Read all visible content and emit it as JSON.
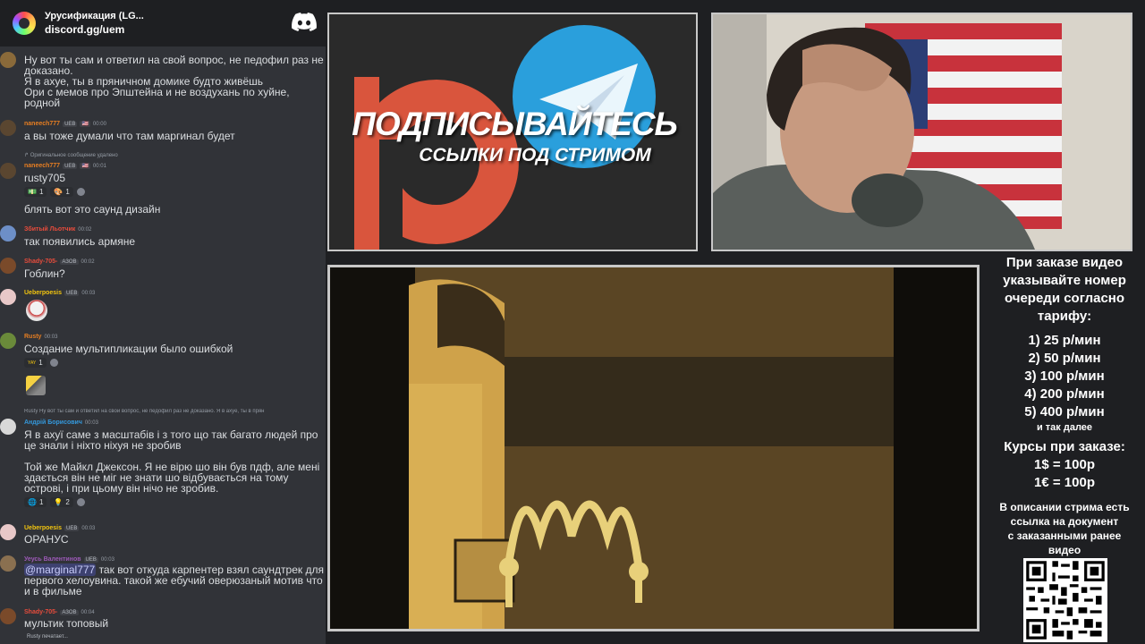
{
  "server": {
    "name": "Урусификация (LG...",
    "invite": "discord.gg/uem",
    "logo_icon": "discord-logo-icon"
  },
  "messages": [
    {
      "id": "m0",
      "body": "Ну вот ты сам и ответил на свой вопрос, не педофил раз не доказано.\nЯ в ахуе, ты в пряничном домике будто живёшь\nОри с мемов про Эпштейна и не воздухань по хуйне, родной"
    },
    {
      "id": "m1",
      "author": "naneech777",
      "badge1": "UEB",
      "badge2": "🇺🇸",
      "time": "00:00",
      "author_color": "#e67e22",
      "body": "а вы тоже думали что там маргинал будет"
    },
    {
      "id": "m2",
      "reply": "↱ Оригинальное сообщение удалено",
      "author": "naneech777",
      "badge1": "UEB",
      "badge2": "🇺🇸",
      "time": "00:01",
      "author_color": "#e67e22",
      "body": "rusty705",
      "reacts": [
        {
          "emoji": "💵",
          "count": "1"
        },
        {
          "emoji": "🎨",
          "count": "1"
        }
      ]
    },
    {
      "id": "m3",
      "body": "блять вот это саунд дизайн"
    },
    {
      "id": "m4",
      "author": "Збитый Льотчик",
      "time": "00:02",
      "author_color": "#e74c3c",
      "body": "так появились армяне"
    },
    {
      "id": "m5",
      "author": "Shady-705-",
      "badge1": "АЗОВ",
      "time": "00:02",
      "author_color": "#e74c3c",
      "body": "Гоблин?"
    },
    {
      "id": "m6",
      "author": "Ueberpoesis",
      "badge1": "UEB",
      "time": "00:03",
      "author_color": "#f1c40f"
    },
    {
      "id": "m7",
      "author": "Rusty",
      "time": "00:03",
      "author_color": "#e67e22",
      "body": "Создание мультипликации было ошибкой",
      "reacts": [
        {
          "emoji": "YAY",
          "count": "1"
        }
      ]
    },
    {
      "id": "m8",
      "reply": "Rusty Ну вот ты сам и ответил на свой вопрос, не педофил раз не доказано. Я в ахуе, ты в прян",
      "author": "Андрій Борисович",
      "time": "00:03",
      "author_color": "#3498db",
      "body": "Я в ахуї саме з масштабів і з того що так багато людей про це знали і ніхто ніхуя не зробив",
      "body2": "Той же Майкл Джексон. Я не вірю шо він був пдф, але мені здається він не міг не знати шо відбувається на тому острові, і при цьому він нічо не зробив.",
      "reacts": [
        {
          "emoji": "🌐",
          "count": "1"
        },
        {
          "emoji": "💡",
          "count": "2"
        }
      ]
    },
    {
      "id": "m9",
      "author": "Ueberpoesis",
      "badge1": "UEB",
      "time": "00:03",
      "author_color": "#f1c40f",
      "body": "ОРАНУС"
    },
    {
      "id": "m10",
      "author": "Уеусь Валентинов",
      "badge1": "UEB",
      "time": "00:03",
      "author_color": "#9b59b6",
      "mention": "@marginal777",
      "body": " так вот откуда карпентер взял саундтрек для первого хелоувина. такой же ебучий оверюзаный мотив что и в фильме"
    },
    {
      "id": "m11",
      "author": "Shady-705-",
      "badge1": "АЗОВ",
      "time": "00:04",
      "author_color": "#e74c3c",
      "body": "мультик топовый"
    }
  ],
  "typing": "Rusty печатает...",
  "promo": {
    "title": "ПОДПИСЫВАЙТЕСЬ",
    "subtitle": "ССЫЛКИ ПОД СТРИМОМ",
    "icons": [
      "patreon-logo-icon",
      "telegram-logo-icon"
    ],
    "colors": {
      "patreon": "#d9553d",
      "telegram": "#2a9fdc"
    }
  },
  "info": {
    "intro": [
      "При заказе видео",
      "указывайте номер",
      "очереди согласно",
      "тарифу:"
    ],
    "tariffs": [
      "1) 25 р/мин",
      "2) 50 р/мин",
      "3) 100 р/мин",
      "4) 200 р/мин",
      "5) 400 р/мин"
    ],
    "tariffs_more": "и так далее",
    "rates_title": "Курсы при заказе:",
    "rates": [
      "1$ = 100р",
      "1€ = 100р"
    ],
    "note": [
      "В описании стрима есть",
      "ссылка на документ",
      "с заказанными ранее",
      "видео"
    ],
    "qr_icon": "qr-code-icon"
  }
}
